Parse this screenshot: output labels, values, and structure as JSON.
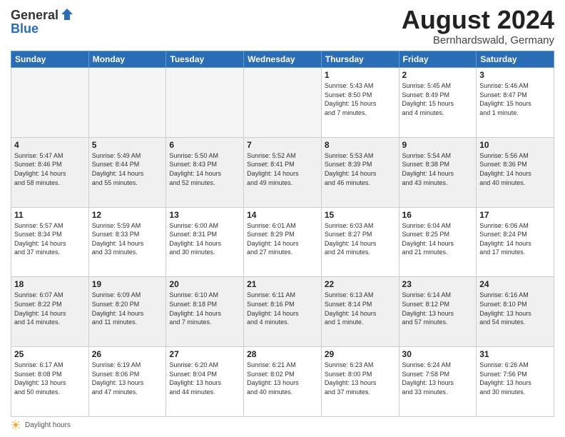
{
  "header": {
    "logo_general": "General",
    "logo_blue": "Blue",
    "month_year": "August 2024",
    "location": "Bernhardswald, Germany"
  },
  "footer": {
    "daylight_hours_label": "Daylight hours"
  },
  "days_of_week": [
    "Sunday",
    "Monday",
    "Tuesday",
    "Wednesday",
    "Thursday",
    "Friday",
    "Saturday"
  ],
  "weeks": [
    [
      {
        "day": "",
        "info": "",
        "empty": true
      },
      {
        "day": "",
        "info": "",
        "empty": true
      },
      {
        "day": "",
        "info": "",
        "empty": true
      },
      {
        "day": "",
        "info": "",
        "empty": true
      },
      {
        "day": "1",
        "info": "Sunrise: 5:43 AM\nSunset: 8:50 PM\nDaylight: 15 hours\nand 7 minutes."
      },
      {
        "day": "2",
        "info": "Sunrise: 5:45 AM\nSunset: 8:49 PM\nDaylight: 15 hours\nand 4 minutes."
      },
      {
        "day": "3",
        "info": "Sunrise: 5:46 AM\nSunset: 8:47 PM\nDaylight: 15 hours\nand 1 minute."
      }
    ],
    [
      {
        "day": "4",
        "info": "Sunrise: 5:47 AM\nSunset: 8:46 PM\nDaylight: 14 hours\nand 58 minutes."
      },
      {
        "day": "5",
        "info": "Sunrise: 5:49 AM\nSunset: 8:44 PM\nDaylight: 14 hours\nand 55 minutes."
      },
      {
        "day": "6",
        "info": "Sunrise: 5:50 AM\nSunset: 8:43 PM\nDaylight: 14 hours\nand 52 minutes."
      },
      {
        "day": "7",
        "info": "Sunrise: 5:52 AM\nSunset: 8:41 PM\nDaylight: 14 hours\nand 49 minutes."
      },
      {
        "day": "8",
        "info": "Sunrise: 5:53 AM\nSunset: 8:39 PM\nDaylight: 14 hours\nand 46 minutes."
      },
      {
        "day": "9",
        "info": "Sunrise: 5:54 AM\nSunset: 8:38 PM\nDaylight: 14 hours\nand 43 minutes."
      },
      {
        "day": "10",
        "info": "Sunrise: 5:56 AM\nSunset: 8:36 PM\nDaylight: 14 hours\nand 40 minutes."
      }
    ],
    [
      {
        "day": "11",
        "info": "Sunrise: 5:57 AM\nSunset: 8:34 PM\nDaylight: 14 hours\nand 37 minutes."
      },
      {
        "day": "12",
        "info": "Sunrise: 5:59 AM\nSunset: 8:33 PM\nDaylight: 14 hours\nand 33 minutes."
      },
      {
        "day": "13",
        "info": "Sunrise: 6:00 AM\nSunset: 8:31 PM\nDaylight: 14 hours\nand 30 minutes."
      },
      {
        "day": "14",
        "info": "Sunrise: 6:01 AM\nSunset: 8:29 PM\nDaylight: 14 hours\nand 27 minutes."
      },
      {
        "day": "15",
        "info": "Sunrise: 6:03 AM\nSunset: 8:27 PM\nDaylight: 14 hours\nand 24 minutes."
      },
      {
        "day": "16",
        "info": "Sunrise: 6:04 AM\nSunset: 8:25 PM\nDaylight: 14 hours\nand 21 minutes."
      },
      {
        "day": "17",
        "info": "Sunrise: 6:06 AM\nSunset: 8:24 PM\nDaylight: 14 hours\nand 17 minutes."
      }
    ],
    [
      {
        "day": "18",
        "info": "Sunrise: 6:07 AM\nSunset: 8:22 PM\nDaylight: 14 hours\nand 14 minutes."
      },
      {
        "day": "19",
        "info": "Sunrise: 6:09 AM\nSunset: 8:20 PM\nDaylight: 14 hours\nand 11 minutes."
      },
      {
        "day": "20",
        "info": "Sunrise: 6:10 AM\nSunset: 8:18 PM\nDaylight: 14 hours\nand 7 minutes."
      },
      {
        "day": "21",
        "info": "Sunrise: 6:11 AM\nSunset: 8:16 PM\nDaylight: 14 hours\nand 4 minutes."
      },
      {
        "day": "22",
        "info": "Sunrise: 6:13 AM\nSunset: 8:14 PM\nDaylight: 14 hours\nand 1 minute."
      },
      {
        "day": "23",
        "info": "Sunrise: 6:14 AM\nSunset: 8:12 PM\nDaylight: 13 hours\nand 57 minutes."
      },
      {
        "day": "24",
        "info": "Sunrise: 6:16 AM\nSunset: 8:10 PM\nDaylight: 13 hours\nand 54 minutes."
      }
    ],
    [
      {
        "day": "25",
        "info": "Sunrise: 6:17 AM\nSunset: 8:08 PM\nDaylight: 13 hours\nand 50 minutes."
      },
      {
        "day": "26",
        "info": "Sunrise: 6:19 AM\nSunset: 8:06 PM\nDaylight: 13 hours\nand 47 minutes."
      },
      {
        "day": "27",
        "info": "Sunrise: 6:20 AM\nSunset: 8:04 PM\nDaylight: 13 hours\nand 44 minutes."
      },
      {
        "day": "28",
        "info": "Sunrise: 6:21 AM\nSunset: 8:02 PM\nDaylight: 13 hours\nand 40 minutes."
      },
      {
        "day": "29",
        "info": "Sunrise: 6:23 AM\nSunset: 8:00 PM\nDaylight: 13 hours\nand 37 minutes."
      },
      {
        "day": "30",
        "info": "Sunrise: 6:24 AM\nSunset: 7:58 PM\nDaylight: 13 hours\nand 33 minutes."
      },
      {
        "day": "31",
        "info": "Sunrise: 6:26 AM\nSunset: 7:56 PM\nDaylight: 13 hours\nand 30 minutes."
      }
    ]
  ]
}
